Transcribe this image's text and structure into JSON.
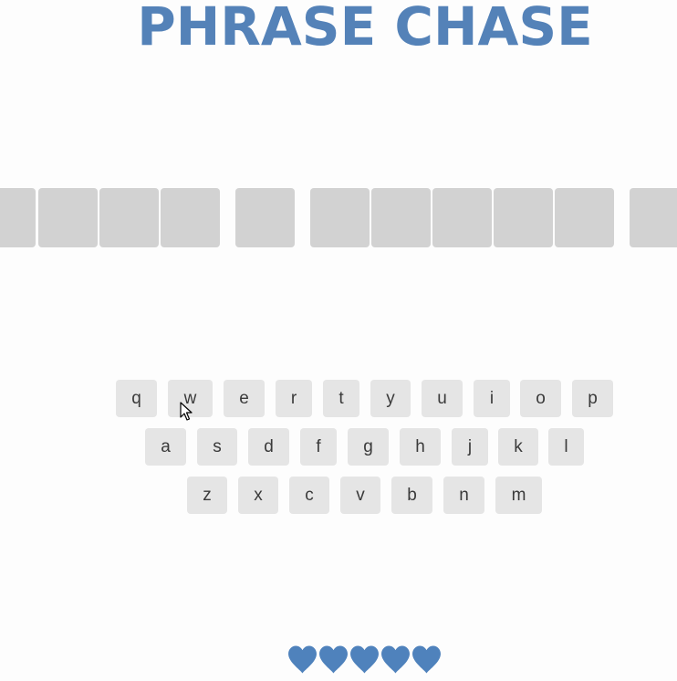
{
  "title": "PHRASE CHASE",
  "accent_color": "#5482b8",
  "phrase": {
    "words": [
      {
        "letters": 4,
        "partially_visible": true
      },
      {
        "letters": 1
      },
      {
        "letters": 5
      },
      {
        "letters": 1,
        "partially_visible": true
      }
    ],
    "tile_color": "#d2d2d2"
  },
  "keyboard": {
    "rows": [
      [
        "q",
        "w",
        "e",
        "r",
        "t",
        "y",
        "u",
        "i",
        "o",
        "p"
      ],
      [
        "a",
        "s",
        "d",
        "f",
        "g",
        "h",
        "j",
        "k",
        "l"
      ],
      [
        "z",
        "x",
        "c",
        "v",
        "b",
        "n",
        "m"
      ]
    ],
    "key_color": "#e5e5e5"
  },
  "lives": {
    "remaining": 5,
    "icon": "heart-icon",
    "color": "#4f82bc"
  }
}
